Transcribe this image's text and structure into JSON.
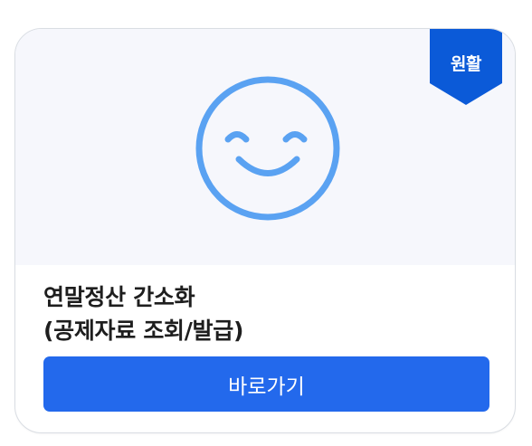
{
  "card": {
    "badge": {
      "label": "원활",
      "color": "#0b5ad8"
    },
    "illustration": {
      "icon": "smiley-face-icon",
      "color": "#5aa2f2",
      "background": "#f6f7fc"
    },
    "title_lines": [
      "연말정산 간소화",
      "(공제자료 조회/발급)"
    ],
    "button": {
      "label": "바로가기",
      "color": "#2369ec"
    }
  }
}
